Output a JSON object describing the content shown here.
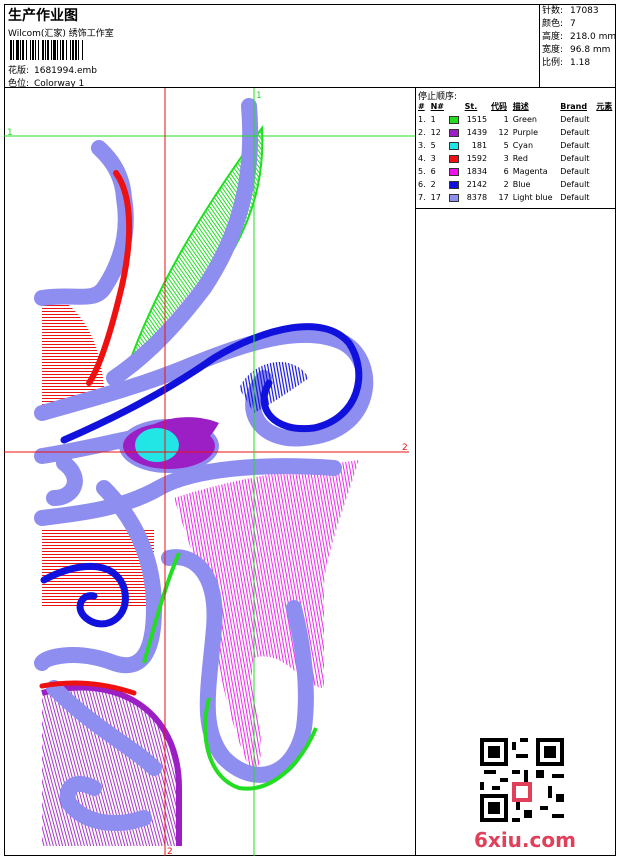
{
  "header": {
    "title": "生产作业图",
    "studio": "Wilcom(汇家) 绣饰工作室",
    "design_label": "花版:",
    "design_value": "1681994.emb",
    "colorway_label": "色位:",
    "colorway_value": "Colorway 1"
  },
  "info": {
    "stitches_label": "针数:",
    "stitches_value": "17083",
    "colors_label": "颜色:",
    "colors_value": "7",
    "height_label": "高度:",
    "height_value": "218.0 mm",
    "width_label": "宽度:",
    "width_value": "96.8 mm",
    "scale_label": "比例:",
    "scale_value": "1.18"
  },
  "stop_sequence": {
    "title": "停止顺序:",
    "columns": [
      "#",
      "N#",
      "St.",
      "代码",
      "描述",
      "Brand",
      "元素"
    ],
    "rows": [
      {
        "idx": "1.",
        "n": "1",
        "st": "1515",
        "code": "1",
        "desc": "Green",
        "brand": "Default",
        "color": "#22dd22"
      },
      {
        "idx": "2.",
        "n": "12",
        "st": "1439",
        "code": "12",
        "desc": "Purple",
        "brand": "Default",
        "color": "#9b1fc4"
      },
      {
        "idx": "3.",
        "n": "5",
        "st": "181",
        "code": "5",
        "desc": "Cyan",
        "brand": "Default",
        "color": "#22e6e6"
      },
      {
        "idx": "4.",
        "n": "3",
        "st": "1592",
        "code": "3",
        "desc": "Red",
        "brand": "Default",
        "color": "#ee1111"
      },
      {
        "idx": "5.",
        "n": "6",
        "st": "1834",
        "code": "6",
        "desc": "Magenta",
        "brand": "Default",
        "color": "#ee11ee"
      },
      {
        "idx": "6.",
        "n": "2",
        "st": "2142",
        "code": "2",
        "desc": "Blue",
        "brand": "Default",
        "color": "#1111dd"
      },
      {
        "idx": "7.",
        "n": "17",
        "st": "8378",
        "code": "17",
        "desc": "Light blue",
        "brand": "Default",
        "color": "#8e8ef0"
      }
    ]
  },
  "guides": {
    "h1": "1",
    "h2": "2",
    "v1": "1",
    "v2": "2"
  },
  "watermark": "6xiu.com"
}
